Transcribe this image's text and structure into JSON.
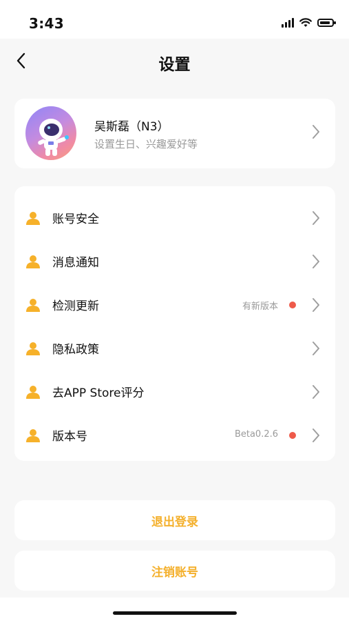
{
  "status_bar": {
    "time": "3:43",
    "icons": [
      "signal-icon",
      "wifi-icon",
      "battery-icon"
    ]
  },
  "navbar": {
    "title": "设置",
    "back_icon": "chevron-left-icon"
  },
  "profile": {
    "name": "吴斯磊（N3）",
    "subtitle": "设置生日、兴趣爱好等",
    "avatar_icon": "astronaut-avatar"
  },
  "menu": {
    "items": [
      {
        "label": "账号安全",
        "value": "",
        "dot": false
      },
      {
        "label": "消息通知",
        "value": "",
        "dot": false
      },
      {
        "label": "检测更新",
        "value": "有新版本",
        "dot": true
      },
      {
        "label": "隐私政策",
        "value": "",
        "dot": false
      },
      {
        "label": "去APP Store评分",
        "value": "",
        "dot": false
      },
      {
        "label": "版本号",
        "value": "Beta0.2.6",
        "dot": true
      }
    ],
    "item_icon": "user-icon"
  },
  "actions": {
    "logout_label": "退出登录",
    "cancel_account_label": "注销账号"
  },
  "colors": {
    "accent": "#f4b02c",
    "badge": "#ee5a4a",
    "background": "#f7f7f7",
    "secondary_text": "#9a9a9a"
  }
}
